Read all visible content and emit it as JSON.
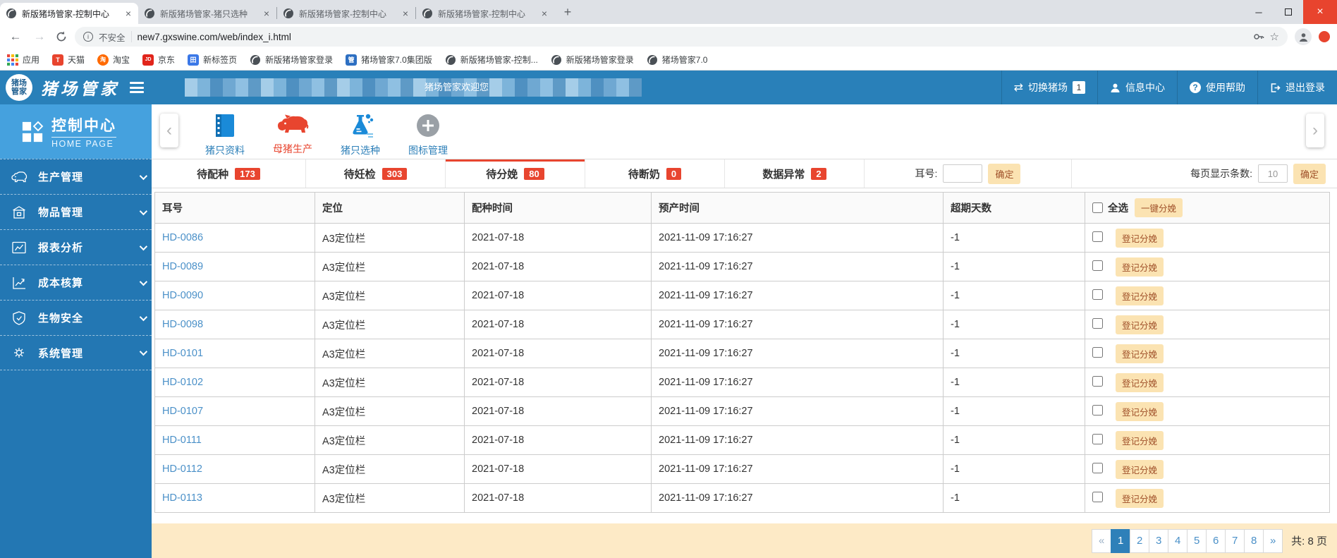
{
  "browser": {
    "tabs": [
      {
        "title": "新版猪场管家-控制中心",
        "close": "×",
        "active": true
      },
      {
        "title": "新版猪场管家-猪只选种",
        "close": "×"
      },
      {
        "title": "新版猪场管家-控制中心",
        "close": "×"
      },
      {
        "title": "新版猪场管家-控制中心",
        "close": "×"
      }
    ],
    "address": {
      "security_label": "不安全",
      "url": "new7.gxswine.com/web/index_i.html"
    },
    "bookmarks": [
      {
        "label": "应用",
        "icon": "apps-grid-icon"
      },
      {
        "label": "天猫",
        "icon": "tmall-icon"
      },
      {
        "label": "淘宝",
        "icon": "taobao-icon"
      },
      {
        "label": "京东",
        "icon": "jd-icon"
      },
      {
        "label": "新标签页",
        "icon": "new-tab-page-icon"
      },
      {
        "label": "新版猪场管家登录",
        "icon": "site-favicon"
      },
      {
        "label": "猪场管家7.0集团版",
        "icon": "site-badge-icon"
      },
      {
        "label": "新版猪场管家-控制...",
        "icon": "site-favicon"
      },
      {
        "label": "新版猪场管家登录",
        "icon": "site-favicon"
      },
      {
        "label": "猪场管家7.0",
        "icon": "site-favicon"
      }
    ]
  },
  "header": {
    "logo_line1": "猪场",
    "logo_line2": "管家",
    "brand": "猪场管家",
    "welcome": "猪场管家欢迎您",
    "actions": [
      {
        "label": "切换猪场",
        "icon": "switch-farm-icon",
        "badge": "1"
      },
      {
        "label": "信息中心",
        "icon": "user-icon"
      },
      {
        "label": "使用帮助",
        "icon": "help-icon"
      },
      {
        "label": "退出登录",
        "icon": "logout-icon"
      }
    ]
  },
  "sidebar": {
    "title": "控制中心",
    "subtitle": "HOME PAGE",
    "items": [
      {
        "label": "生产管理",
        "icon": "pig-icon"
      },
      {
        "label": "物品管理",
        "icon": "goods-icon"
      },
      {
        "label": "报表分析",
        "icon": "report-chart-icon"
      },
      {
        "label": "成本核算",
        "icon": "cost-chart-icon"
      },
      {
        "label": "生物安全",
        "icon": "biosecurity-shield-icon"
      },
      {
        "label": "系统管理",
        "icon": "system-gear-icon"
      }
    ]
  },
  "toolbar": {
    "items": [
      {
        "label": "猪只资料",
        "icon": "notebook-icon",
        "color": "blue"
      },
      {
        "label": "母猪生产",
        "icon": "sow-pig-icon",
        "color": "red"
      },
      {
        "label": "猪只选种",
        "icon": "flask-icon",
        "color": "blue"
      },
      {
        "label": "图标管理",
        "icon": "plus-circle-icon",
        "color": "blue"
      }
    ]
  },
  "status_tabs": [
    {
      "label": "待配种",
      "count": "173"
    },
    {
      "label": "待妊检",
      "count": "303"
    },
    {
      "label": "待分娩",
      "count": "80",
      "active": true
    },
    {
      "label": "待断奶",
      "count": "0"
    },
    {
      "label": "数据异常",
      "count": "2"
    }
  ],
  "filters": {
    "ear_tag_label": "耳号:",
    "ear_tag_value": "",
    "confirm_label": "确定",
    "page_size_label": "每页显示条数:",
    "page_size_value": "10"
  },
  "table": {
    "headers": [
      "耳号",
      "定位",
      "配种时间",
      "预产时间",
      "超期天数"
    ],
    "select_all_label": "全选",
    "batch_action_label": "一键分娩",
    "row_action_label": "登记分娩",
    "rows": [
      {
        "ear_tag": "HD-0086",
        "location": "A3定位栏",
        "breeding_date": "2021-07-18",
        "due_date": "2021-11-09 17:16:27",
        "overdue_days": "-1"
      },
      {
        "ear_tag": "HD-0089",
        "location": "A3定位栏",
        "breeding_date": "2021-07-18",
        "due_date": "2021-11-09 17:16:27",
        "overdue_days": "-1"
      },
      {
        "ear_tag": "HD-0090",
        "location": "A3定位栏",
        "breeding_date": "2021-07-18",
        "due_date": "2021-11-09 17:16:27",
        "overdue_days": "-1"
      },
      {
        "ear_tag": "HD-0098",
        "location": "A3定位栏",
        "breeding_date": "2021-07-18",
        "due_date": "2021-11-09 17:16:27",
        "overdue_days": "-1"
      },
      {
        "ear_tag": "HD-0101",
        "location": "A3定位栏",
        "breeding_date": "2021-07-18",
        "due_date": "2021-11-09 17:16:27",
        "overdue_days": "-1"
      },
      {
        "ear_tag": "HD-0102",
        "location": "A3定位栏",
        "breeding_date": "2021-07-18",
        "due_date": "2021-11-09 17:16:27",
        "overdue_days": "-1"
      },
      {
        "ear_tag": "HD-0107",
        "location": "A3定位栏",
        "breeding_date": "2021-07-18",
        "due_date": "2021-11-09 17:16:27",
        "overdue_days": "-1"
      },
      {
        "ear_tag": "HD-0111",
        "location": "A3定位栏",
        "breeding_date": "2021-07-18",
        "due_date": "2021-11-09 17:16:27",
        "overdue_days": "-1"
      },
      {
        "ear_tag": "HD-0112",
        "location": "A3定位栏",
        "breeding_date": "2021-07-18",
        "due_date": "2021-11-09 17:16:27",
        "overdue_days": "-1"
      },
      {
        "ear_tag": "HD-0113",
        "location": "A3定位栏",
        "breeding_date": "2021-07-18",
        "due_date": "2021-11-09 17:16:27",
        "overdue_days": "-1"
      }
    ]
  },
  "pagination": {
    "prev": "«",
    "next": "»",
    "pages": [
      "1",
      "2",
      "3",
      "4",
      "5",
      "6",
      "7",
      "8"
    ],
    "active_page": "1",
    "total_label": "共: 8 页"
  },
  "colors": {
    "header_blue": "#2980b9",
    "sidebar_blue": "#2377b3",
    "home_panel_blue": "#45a1de",
    "accent_red": "#e8452f",
    "link_blue": "#4a90c8",
    "wheat_button_bg": "#fbe3b2",
    "wheat_button_text": "#a0512a",
    "pagination_bar_bg": "#fdeac6",
    "active_page_bg": "#2e80b9"
  }
}
